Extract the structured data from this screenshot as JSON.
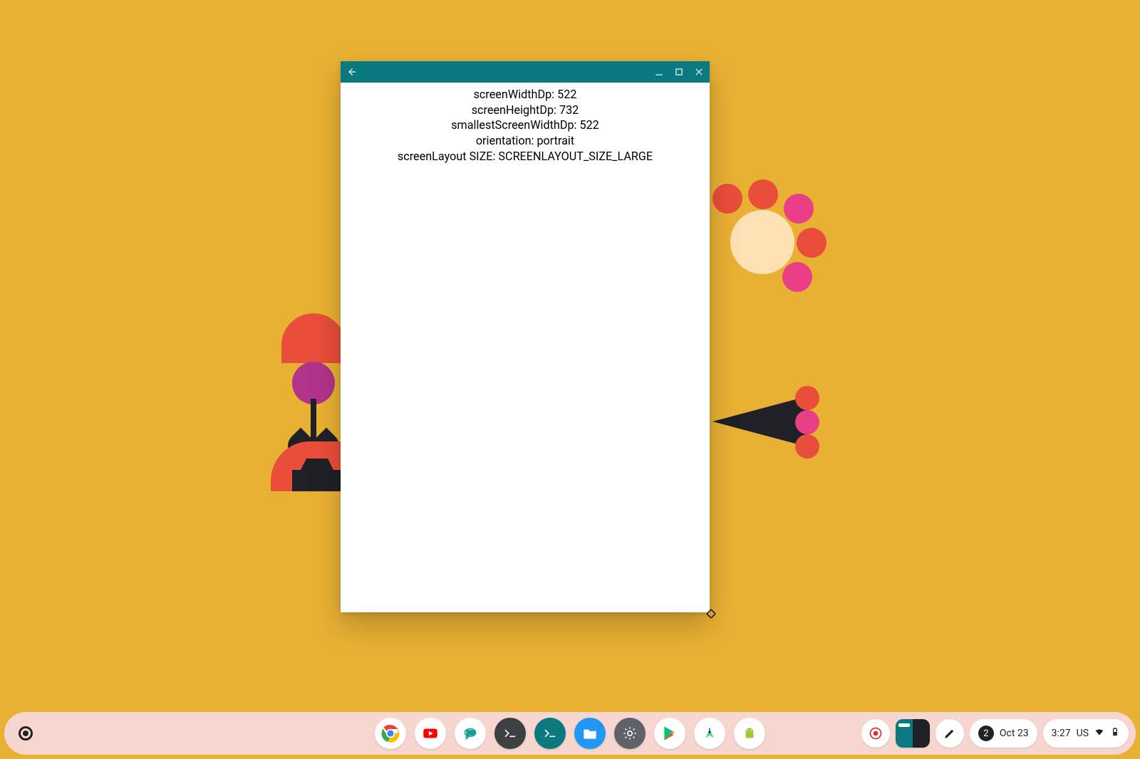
{
  "window": {
    "lines": [
      "screenWidthDp: 522",
      "screenHeightDp: 732",
      "smallestScreenWidthDp: 522",
      "orientation: portrait",
      "screenLayout SIZE: SCREENLAYOUT_SIZE_LARGE"
    ]
  },
  "shelf": {
    "apps": [
      {
        "name": "chrome"
      },
      {
        "name": "youtube"
      },
      {
        "name": "messages"
      },
      {
        "name": "terminal"
      },
      {
        "name": "linux-terminal"
      },
      {
        "name": "files"
      },
      {
        "name": "settings"
      },
      {
        "name": "play-store"
      },
      {
        "name": "android-studio"
      },
      {
        "name": "android-debug"
      }
    ],
    "status": {
      "notification_count": "2",
      "date": "Oct 23",
      "time": "3:27",
      "kbd": "US"
    }
  }
}
